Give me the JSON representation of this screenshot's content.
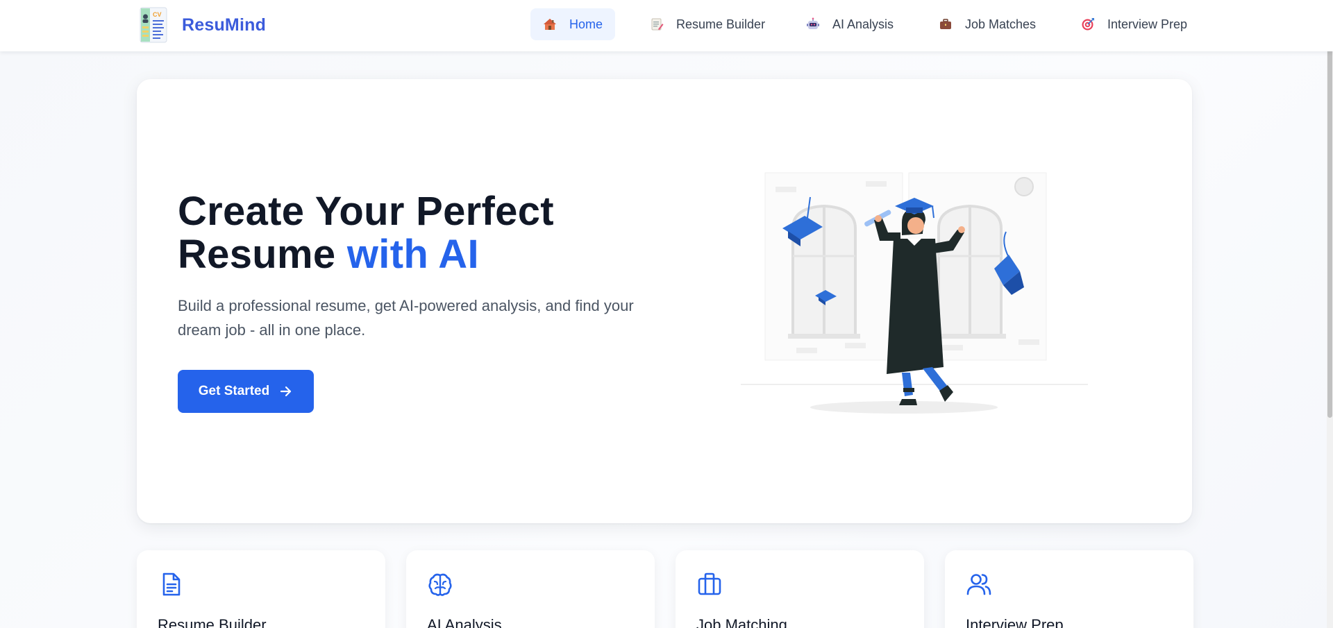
{
  "brand": {
    "name": "ResuMind",
    "logo_icon": "cv-document-icon"
  },
  "nav": [
    {
      "label": "Home",
      "icon": "house-icon",
      "active": true
    },
    {
      "label": "Resume Builder",
      "icon": "memo-icon",
      "active": false
    },
    {
      "label": "AI Analysis",
      "icon": "robot-icon",
      "active": false
    },
    {
      "label": "Job Matches",
      "icon": "briefcase-icon",
      "active": false
    },
    {
      "label": "Interview Prep",
      "icon": "target-icon",
      "active": false
    }
  ],
  "hero": {
    "title_line1": "Create Your Perfect",
    "title_line2_plain": "Resume ",
    "title_line2_accent": "with AI",
    "subtitle": "Build a professional resume, get AI-powered analysis, and find your dream job - all in one place.",
    "cta_label": "Get Started"
  },
  "features": [
    {
      "title": "Resume Builder",
      "icon": "document-icon"
    },
    {
      "title": "AI Analysis",
      "icon": "brain-icon"
    },
    {
      "title": "Job Matching",
      "icon": "briefcase-icon"
    },
    {
      "title": "Interview Prep",
      "icon": "users-icon"
    }
  ],
  "colors": {
    "accent": "#2563eb",
    "brand": "#3b5bdb",
    "text": "#111827",
    "muted": "#4b5563"
  }
}
